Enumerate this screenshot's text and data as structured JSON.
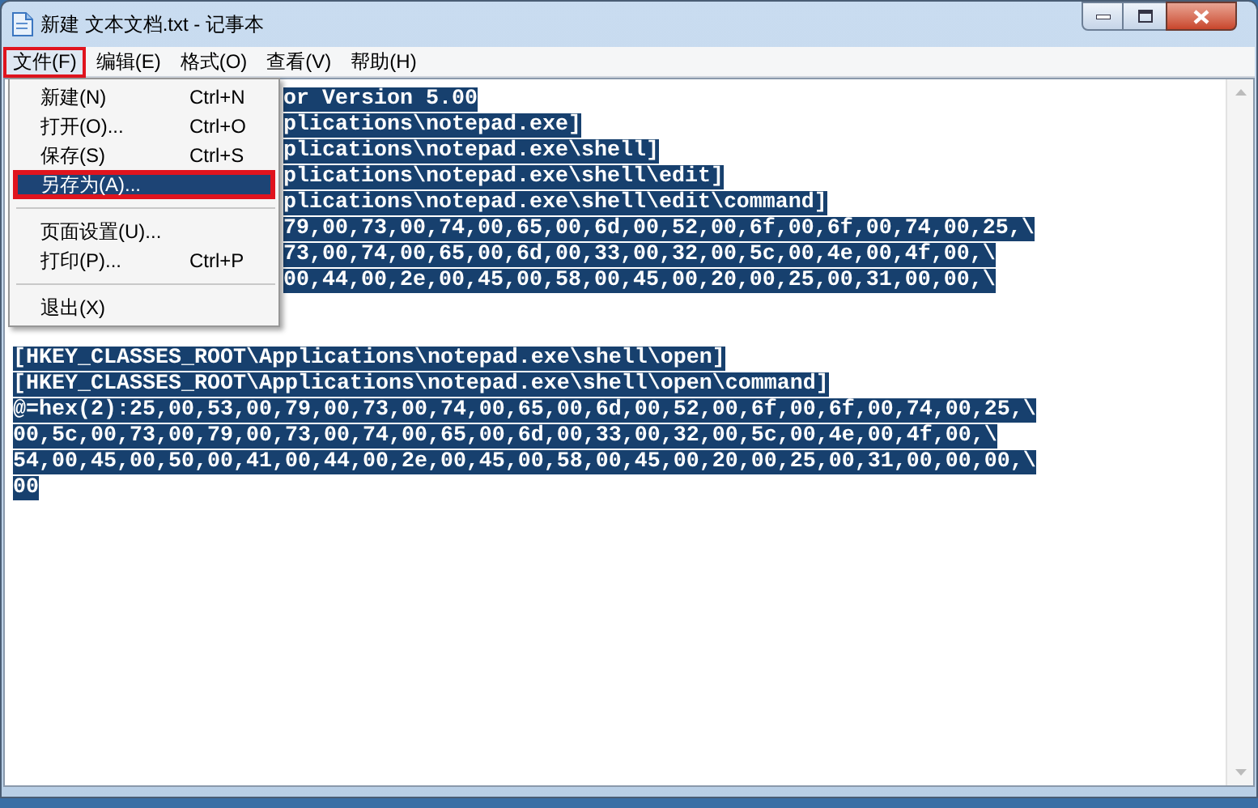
{
  "window": {
    "title": "新建 文本文档.txt - 记事本"
  },
  "menu_bar": [
    {
      "label": "文件(F)",
      "selected": true,
      "annotated": true
    },
    {
      "label": "编辑(E)",
      "selected": false,
      "annotated": false
    },
    {
      "label": "格式(O)",
      "selected": false,
      "annotated": false
    },
    {
      "label": "查看(V)",
      "selected": false,
      "annotated": false
    },
    {
      "label": "帮助(H)",
      "selected": false,
      "annotated": false
    }
  ],
  "file_menu": [
    {
      "kind": "item",
      "label": "新建(N)",
      "shortcut": "Ctrl+N",
      "selected": false,
      "annotated": false
    },
    {
      "kind": "item",
      "label": "打开(O)...",
      "shortcut": "Ctrl+O",
      "selected": false,
      "annotated": false
    },
    {
      "kind": "item",
      "label": "保存(S)",
      "shortcut": "Ctrl+S",
      "selected": false,
      "annotated": false
    },
    {
      "kind": "item",
      "label": "另存为(A)...",
      "selected": true,
      "annotated": true
    },
    {
      "kind": "separator"
    },
    {
      "kind": "item",
      "label": "页面设置(U)...",
      "selected": false,
      "annotated": false
    },
    {
      "kind": "item",
      "label": "打印(P)...",
      "shortcut": "Ctrl+P",
      "selected": false,
      "annotated": false
    },
    {
      "kind": "separator"
    },
    {
      "kind": "item",
      "label": "退出(X)",
      "selected": false,
      "annotated": false
    }
  ],
  "editor": {
    "lines": [
      {
        "kind": "text",
        "text": "or Version 5.00",
        "partly_covered": true,
        "selected": true
      },
      {
        "kind": "text",
        "text": "plications\\notepad.exe]",
        "partly_covered": true,
        "selected": true
      },
      {
        "kind": "text",
        "text": "plications\\notepad.exe\\shell]",
        "partly_covered": true,
        "selected": true
      },
      {
        "kind": "text",
        "text": "plications\\notepad.exe\\shell\\edit]",
        "partly_covered": true,
        "selected": true
      },
      {
        "kind": "text",
        "text": "plications\\notepad.exe\\shell\\edit\\command]",
        "partly_covered": true,
        "selected": true
      },
      {
        "kind": "text",
        "text": "79,00,73,00,74,00,65,00,6d,00,52,00,6f,00,6f,00,74,00,25,\\",
        "partly_covered": true,
        "selected": true
      },
      {
        "kind": "text",
        "text": "73,00,74,00,65,00,6d,00,33,00,32,00,5c,00,4e,00,4f,00,\\",
        "partly_covered": true,
        "selected": true
      },
      {
        "kind": "text",
        "text": "00,44,00,2e,00,45,00,58,00,45,00,20,00,25,00,31,00,00,\\",
        "partly_covered": true,
        "selected": true
      },
      {
        "kind": "blank"
      },
      {
        "kind": "blank"
      },
      {
        "kind": "text",
        "text": "[HKEY_CLASSES_ROOT\\Applications\\notepad.exe\\shell\\open]",
        "partly_covered": false,
        "selected": true
      },
      {
        "kind": "text",
        "text": "[HKEY_CLASSES_ROOT\\Applications\\notepad.exe\\shell\\open\\command]",
        "partly_covered": false,
        "selected": true
      },
      {
        "kind": "text",
        "text": "@=hex(2):25,00,53,00,79,00,73,00,74,00,65,00,6d,00,52,00,6f,00,6f,00,74,00,25,\\",
        "partly_covered": false,
        "selected": true
      },
      {
        "kind": "text",
        "text": "00,5c,00,73,00,79,00,73,00,74,00,65,00,6d,00,33,00,32,00,5c,00,4e,00,4f,00,\\",
        "partly_covered": false,
        "selected": true
      },
      {
        "kind": "text",
        "text": "54,00,45,00,50,00,41,00,44,00,2e,00,45,00,58,00,45,00,20,00,25,00,31,00,00,00,\\",
        "partly_covered": false,
        "selected": true
      },
      {
        "kind": "text",
        "text": "00",
        "partly_covered": false,
        "selected": true
      }
    ]
  }
}
